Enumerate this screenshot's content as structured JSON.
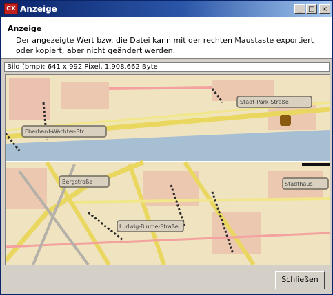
{
  "window": {
    "title": "Anzeige",
    "app_icon_text": "CX",
    "controls": {
      "minimize": "_",
      "maximize": "□",
      "close": "×"
    }
  },
  "header": {
    "title": "Anzeige",
    "description": "Der angezeigte Wert bzw. die Datei kann mit der rechten Maustaste exportiert oder kopiert, aber nicht geändert werden."
  },
  "image_info": "Bild (bmp): 641 x 992 Pixel, 1.908.662 Byte",
  "map": {
    "labels": [
      "Bergstraße",
      "Eberhard-Wächter-Str.",
      "Ludwig-Blume-Straße",
      "Stadthaus",
      "Stadt-Park-Straße"
    ]
  },
  "footer": {
    "close_label": "Schließen"
  }
}
